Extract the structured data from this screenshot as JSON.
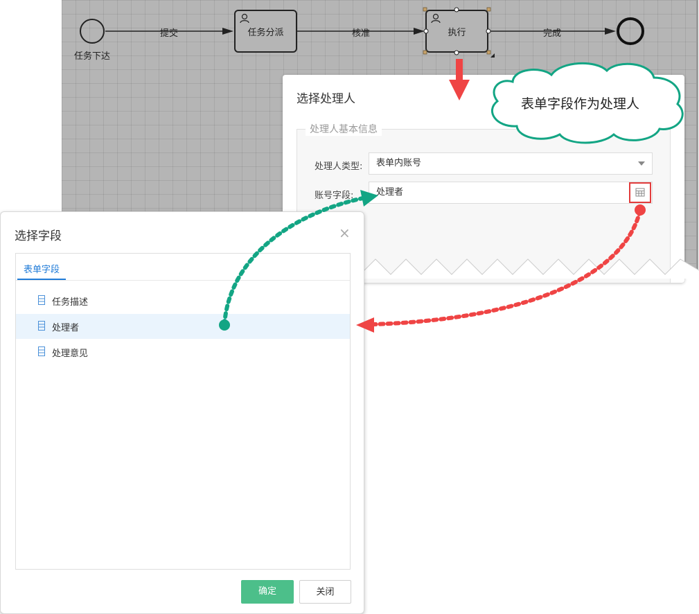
{
  "flow": {
    "start_label": "任务下达",
    "edge1_label": "提交",
    "task1_label": "任务分派",
    "edge2_label": "核准",
    "task2_label": "执行",
    "edge3_label": "完成"
  },
  "handler_panel": {
    "title": "选择处理人",
    "fieldset_legend": "处理人基本信息",
    "type_label": "处理人类型:",
    "type_value": "表单内账号",
    "field_label": "账号字段:",
    "field_value": "处理者",
    "table_icon": "table-icon"
  },
  "callout": {
    "text": "表单字段作为处理人"
  },
  "dialog": {
    "title": "选择字段",
    "close_icon": "×",
    "tab_label": "表单字段",
    "items": [
      {
        "label": "任务描述",
        "icon": "field-icon",
        "selected": false
      },
      {
        "label": "处理者",
        "icon": "field-icon",
        "selected": true
      },
      {
        "label": "处理意见",
        "icon": "field-icon",
        "selected": false
      }
    ],
    "confirm_label": "确定",
    "close_label": "关闭"
  },
  "colors": {
    "accent_blue": "#1f7bd8",
    "confirm_green": "#4cbf8a",
    "arrow_red": "#ef4444",
    "arrow_teal": "#13a584",
    "canvas_gray": "#b5b5b5"
  }
}
